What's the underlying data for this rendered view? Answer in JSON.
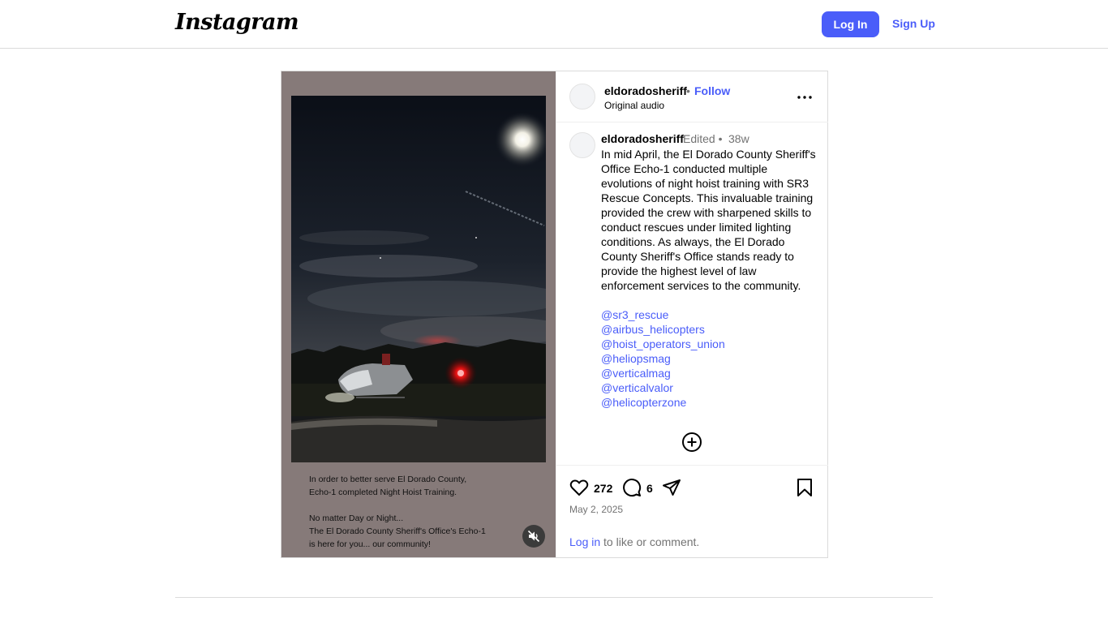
{
  "nav": {
    "logo_text": "Instagram",
    "login_label": "Log In",
    "signup_label": "Sign Up"
  },
  "post": {
    "media": {
      "overlay_lines_1": "In order to better serve El Dorado County,\nEcho-1 completed Night Hoist Training.",
      "overlay_lines_2": "No matter Day or Night...\nThe El Dorado County Sheriff's Office's Echo-1\nis here for you... our community!",
      "mute_icon": "speaker-muted-icon"
    },
    "header": {
      "username": "eldoradosheriff",
      "separator": "•",
      "follow_label": "Follow",
      "audio_label": "Original audio",
      "more_icon": "ellipsis-icon"
    },
    "caption": {
      "username": "eldoradosheriff",
      "edited_label": "Edited •",
      "time": "38w",
      "text": "In mid April, the El Dorado County Sheriff's Office Echo-1 conducted multiple evolutions of night hoist training with SR3 Rescue Concepts. This invaluable training provided the crew with sharpened skills to conduct rescues under limited lighting conditions. As always, the El Dorado County Sheriff's Office stands ready to provide the highest level of law enforcement services to the community.",
      "tags": [
        "@sr3_rescue",
        "@airbus_helicopters",
        "@hoist_operators_union",
        "@heliopsmag",
        "@verticalmag",
        "@verticalvalor",
        "@helicopterzone"
      ],
      "load_more_icon": "plus-circle-icon"
    },
    "actions": {
      "likes": "272",
      "comments": "6",
      "date": "May 2, 2025",
      "login_link": "Log in",
      "login_suffix": " to like or comment."
    }
  },
  "colors": {
    "accent": "#4a5df9",
    "media_bg": "#867a79",
    "muted_text": "#737373",
    "border": "#dbdbdb"
  }
}
